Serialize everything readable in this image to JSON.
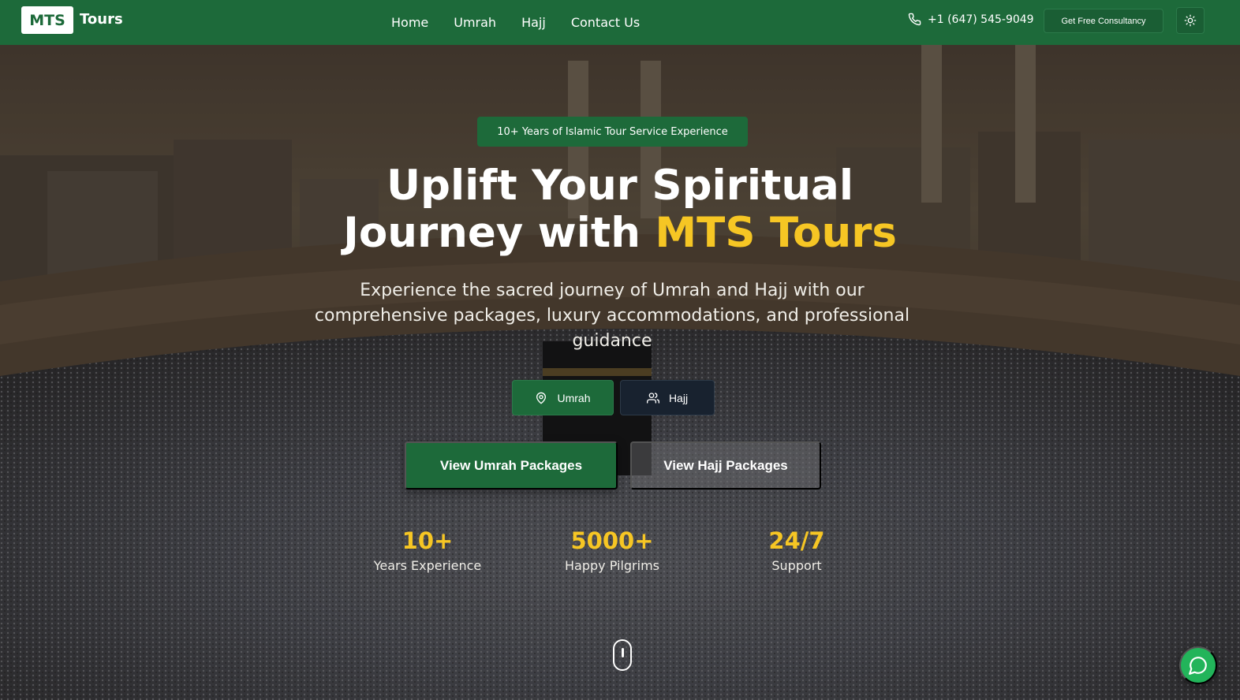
{
  "header": {
    "logo_text": "MTS",
    "brand_name": "Tours",
    "nav": [
      "Home",
      "Umrah",
      "Hajj",
      "Contact Us"
    ],
    "phone": "+1 (647) 545-9049",
    "consult_label": "Get Free Consultancy",
    "theme_icon": "sun-icon"
  },
  "hero": {
    "badge": "10+ Years of Islamic Tour Service Experience",
    "headline_line1": "Uplift Your Spiritual",
    "headline_line2_prefix": "Journey with ",
    "headline_highlight": "MTS Tours",
    "subtitle": "Experience the sacred journey of Umrah and Hajj with our comprehensive packages, luxury accommodations, and professional guidance",
    "toggle": [
      {
        "label": "Umrah",
        "icon": "map-pin-icon"
      },
      {
        "label": "Hajj",
        "icon": "users-icon"
      }
    ],
    "cta_umrah": "View Umrah Packages",
    "cta_hajj": "View Hajj Packages",
    "stats": [
      {
        "value": "10+",
        "label": "Years Experience"
      },
      {
        "value": "5000+",
        "label": "Happy Pilgrims"
      },
      {
        "value": "24/7",
        "label": "Support"
      }
    ]
  },
  "colors": {
    "brand_green": "#1d6a3a",
    "accent_gold": "#f6c624",
    "chat_green": "#22b45a"
  }
}
